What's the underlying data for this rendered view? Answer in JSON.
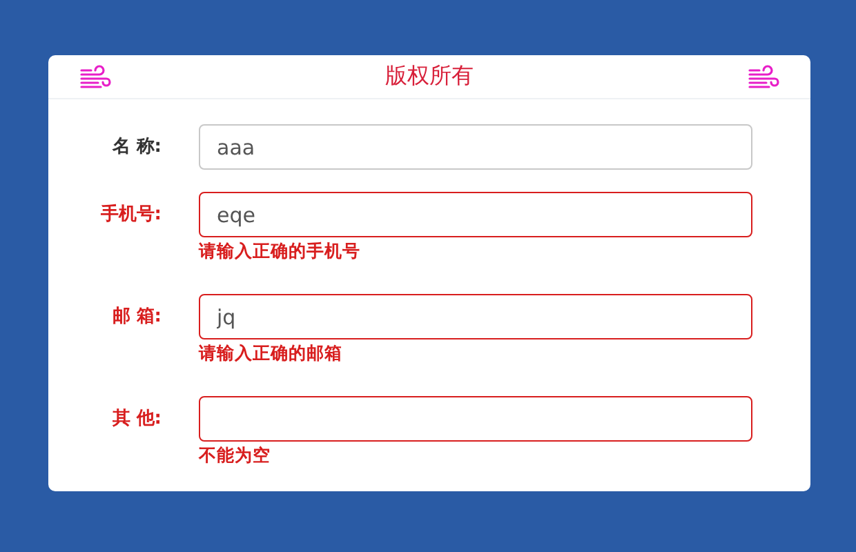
{
  "header": {
    "title": "版权所有"
  },
  "fields": [
    {
      "label": "名 称:",
      "value": "aaa",
      "invalid": false
    },
    {
      "label": "手机号:",
      "value": "eqe",
      "invalid": true,
      "error": "请输入正确的手机号"
    },
    {
      "label": "邮 箱:",
      "value": "jq",
      "invalid": true,
      "error": "请输入正确的邮箱"
    },
    {
      "label": "其 他:",
      "invalid": true,
      "error": "不能为空"
    }
  ]
}
